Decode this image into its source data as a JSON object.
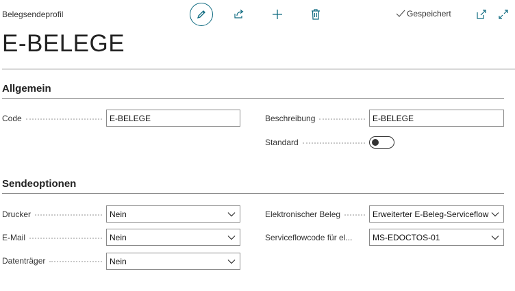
{
  "header": {
    "breadcrumb": "Belegsendeprofil",
    "saved_label": "Gespeichert",
    "title": "E-BELEGE",
    "accent_color": "#0e6a80"
  },
  "toolbar": {
    "icons": [
      "edit-icon",
      "share-icon",
      "add-icon",
      "delete-icon"
    ]
  },
  "sections": {
    "general": {
      "title": "Allgemein",
      "code_label": "Code",
      "code_value": "E-BELEGE",
      "description_label": "Beschreibung",
      "description_value": "E-BELEGE",
      "default_label": "Standard",
      "default_value": false
    },
    "sending": {
      "title": "Sendeoptionen",
      "printer_label": "Drucker",
      "printer_value": "Nein",
      "email_label": "E-Mail",
      "email_value": "Nein",
      "disk_label": "Datenträger",
      "disk_value": "Nein",
      "edoc_label": "Elektronischer Beleg",
      "edoc_value": "Erweiterter E-Beleg-Serviceflow",
      "flowcode_label": "Serviceflowcode für el...",
      "flowcode_value": "MS-EDOCTOS-01"
    }
  }
}
